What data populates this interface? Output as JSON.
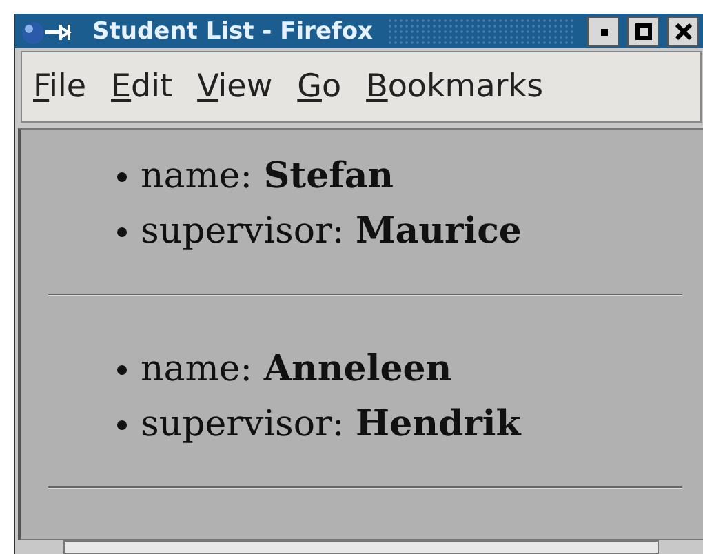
{
  "window": {
    "title": "Student List - Firefox"
  },
  "menu": [
    "File",
    "Edit",
    "View",
    "Go",
    "Bookmarks"
  ],
  "students": [
    {
      "fields": [
        "name: **Stefan**",
        "supervisor: **Maurice**"
      ]
    },
    {
      "fields": [
        "name: **Anneleen**",
        "supervisor: **Hendrik**"
      ]
    }
  ]
}
